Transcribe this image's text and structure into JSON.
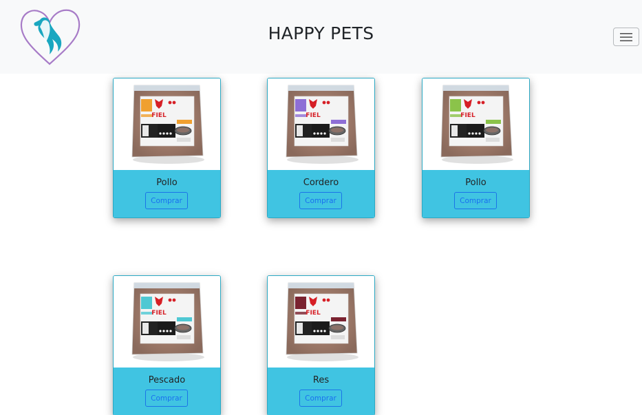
{
  "header": {
    "brand": "HAPPY PETS",
    "logo_icon": "heart-pet-logo-icon",
    "menu_icon": "hamburger-menu-icon"
  },
  "colors": {
    "navbar_bg": "#f8f9fa",
    "card_body": "#40c4e2",
    "button_border": "#1a73e8",
    "logo_purple": "#a77bc7",
    "logo_teal": "#1aa7c0"
  },
  "products": [
    {
      "name": "Pollo",
      "button": "Comprar",
      "label_color": "#f0a030",
      "image_icon": "fiel-bag-image-icon"
    },
    {
      "name": "Cordero",
      "button": "Comprar",
      "label_color": "#8e6fd6",
      "image_icon": "fiel-bag-image-icon"
    },
    {
      "name": "Pollo",
      "button": "Comprar",
      "label_color": "#8bc34a",
      "image_icon": "fiel-bag-image-icon"
    },
    {
      "name": "Pescado",
      "button": "Comprar",
      "label_color": "#4fc8d3",
      "image_icon": "fiel-bag-image-icon"
    },
    {
      "name": "Res",
      "button": "Comprar",
      "label_color": "#7a2230",
      "image_icon": "fiel-bag-image-icon"
    }
  ]
}
